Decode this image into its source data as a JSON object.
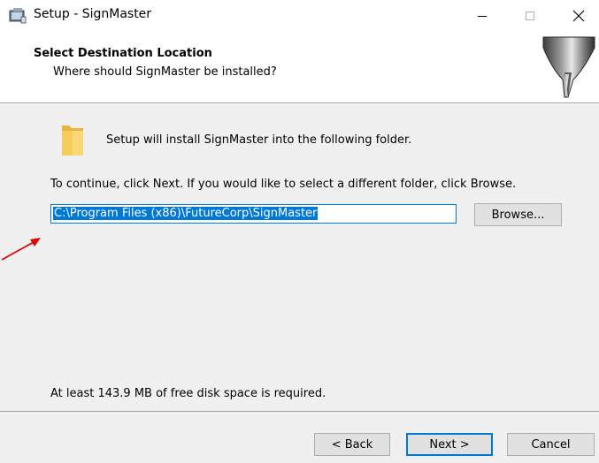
{
  "window": {
    "title": "Setup - SignMaster",
    "minimize_glyph": "—",
    "maximize_glyph": "☐",
    "close_glyph": "✕"
  },
  "header": {
    "title": "Select Destination Location",
    "subtitle": "Where should SignMaster be installed?"
  },
  "body": {
    "intro": "Setup will install SignMaster into the following folder.",
    "instructions": "To continue, click Next. If you would like to select a different folder, click Browse.",
    "path_value": "C:\\Program Files (x86)\\FutureCorp\\SignMaster",
    "browse_label": "Browse...",
    "disk_space": "At least 143.9 MB of free disk space is required."
  },
  "footer": {
    "back_label": "< Back",
    "next_label": "Next >",
    "cancel_label": "Cancel"
  },
  "colors": {
    "accent": "#0078d7",
    "annotation_arrow": "#e00000",
    "dialog_bg": "#f0f0f0"
  },
  "icons": {
    "app": "installer-icon",
    "folder": "folder-icon",
    "wizard": "wizard-drill-image"
  }
}
